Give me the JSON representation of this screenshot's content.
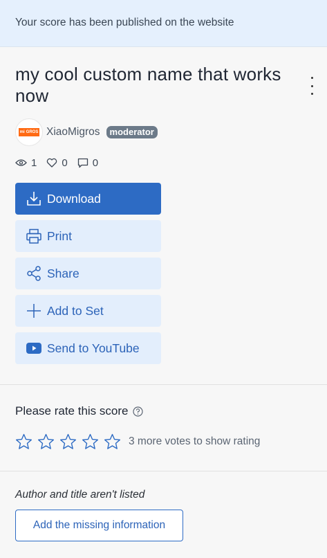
{
  "banner": {
    "text": "Your score has been published on the website"
  },
  "score": {
    "title": "my cool custom name that works now",
    "author": {
      "name": "XiaoMigros",
      "badge": "moderator",
      "avatar_logo_text": [
        "mi",
        "GROS"
      ]
    },
    "stats": {
      "views": "1",
      "likes": "0",
      "comments": "0"
    }
  },
  "actions": {
    "download": "Download",
    "print": "Print",
    "share": "Share",
    "add_to_set": "Add to Set",
    "send_to_youtube": "Send to YouTube"
  },
  "rating": {
    "title": "Please rate this score",
    "stars_count": 5,
    "note": "3 more votes to show rating"
  },
  "missing_info": {
    "text": "Author and title aren't listed",
    "button": "Add the missing information"
  },
  "colors": {
    "accent": "#2d6bc4",
    "button_light": "#e3eefc",
    "banner": "#e5f0fd",
    "youtube_icon": "#2d6bc4"
  },
  "icons": [
    "eye-icon",
    "heart-icon",
    "comment-icon",
    "download-icon",
    "print-icon",
    "share-icon",
    "plus-icon",
    "youtube-icon",
    "question-icon",
    "star-icon",
    "kebab-menu-icon"
  ]
}
